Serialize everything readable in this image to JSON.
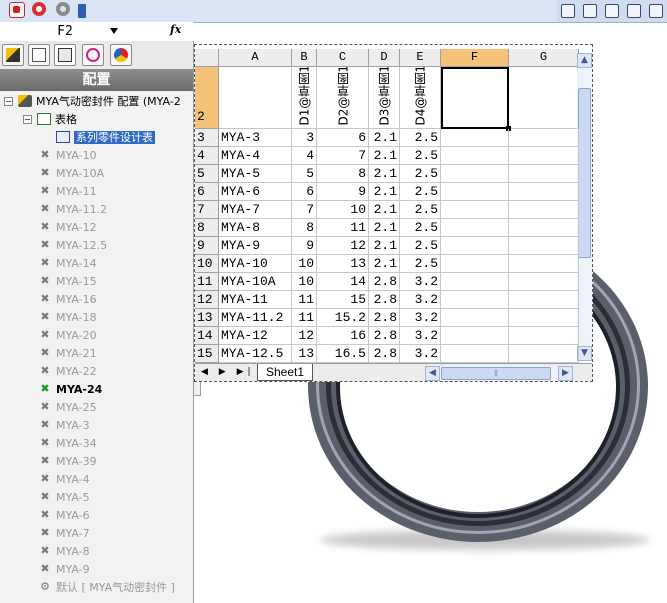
{
  "formula_bar": {
    "name_box": "F2",
    "fx": "fx"
  },
  "panel": {
    "header": "配置"
  },
  "tree": {
    "root": "MYA气动密封件 配置  (MYA-2",
    "tables": "表格",
    "design_table": "系列零件设计表",
    "configs": [
      "MYA-10",
      "MYA-10A",
      "MYA-11",
      "MYA-11.2",
      "MYA-12",
      "MYA-12.5",
      "MYA-14",
      "MYA-15",
      "MYA-16",
      "MYA-18",
      "MYA-20",
      "MYA-21",
      "MYA-22",
      "MYA-24",
      "MYA-25",
      "MYA-3",
      "MYA-34",
      "MYA-39",
      "MYA-4",
      "MYA-5",
      "MYA-6",
      "MYA-7",
      "MYA-8",
      "MYA-9"
    ],
    "active_config": "MYA-24",
    "default": "默认 [ MYA气动密封件 ]"
  },
  "sheet": {
    "columns": [
      "A",
      "B",
      "C",
      "D",
      "E",
      "F",
      "G"
    ],
    "active_column": "F",
    "header_row": "2",
    "headers": [
      "D1@草图1",
      "D2@草图1",
      "D3@草图1",
      "D4@草图1"
    ],
    "rows": [
      {
        "n": "3",
        "a": "MYA-3",
        "b": "3",
        "c": "6",
        "d": "2.1",
        "e": "2.5"
      },
      {
        "n": "4",
        "a": "MYA-4",
        "b": "4",
        "c": "7",
        "d": "2.1",
        "e": "2.5"
      },
      {
        "n": "5",
        "a": "MYA-5",
        "b": "5",
        "c": "8",
        "d": "2.1",
        "e": "2.5"
      },
      {
        "n": "6",
        "a": "MYA-6",
        "b": "6",
        "c": "9",
        "d": "2.1",
        "e": "2.5"
      },
      {
        "n": "7",
        "a": "MYA-7",
        "b": "7",
        "c": "10",
        "d": "2.1",
        "e": "2.5"
      },
      {
        "n": "8",
        "a": "MYA-8",
        "b": "8",
        "c": "11",
        "d": "2.1",
        "e": "2.5"
      },
      {
        "n": "9",
        "a": "MYA-9",
        "b": "9",
        "c": "12",
        "d": "2.1",
        "e": "2.5"
      },
      {
        "n": "10",
        "a": "MYA-10",
        "b": "10",
        "c": "13",
        "d": "2.1",
        "e": "2.5"
      },
      {
        "n": "11",
        "a": "MYA-10A",
        "b": "10",
        "c": "14",
        "d": "2.8",
        "e": "3.2"
      },
      {
        "n": "12",
        "a": "MYA-11",
        "b": "11",
        "c": "15",
        "d": "2.8",
        "e": "3.2"
      },
      {
        "n": "13",
        "a": "MYA-11.2",
        "b": "11",
        "c": "15.2",
        "d": "2.8",
        "e": "3.2"
      },
      {
        "n": "14",
        "a": "MYA-12",
        "b": "12",
        "c": "16",
        "d": "2.8",
        "e": "3.2"
      },
      {
        "n": "15",
        "a": "MYA-12.5",
        "b": "13",
        "c": "16.5",
        "d": "2.8",
        "e": "3.2"
      }
    ],
    "tab": "Sheet1",
    "nav": "◀ ▶ ▶|",
    "hscroll_grip": "⦀"
  }
}
